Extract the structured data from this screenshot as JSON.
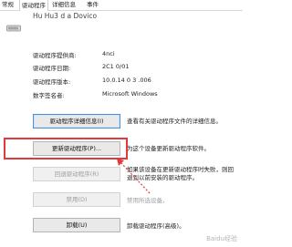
{
  "tabs": [
    "常规",
    "驱动程序",
    "详细信息",
    "事件"
  ],
  "device": {
    "name": "Hu Hu3 d a Dovico",
    "icon": "device-icon"
  },
  "info_rows": [
    {
      "label": "驱动程序提供商:",
      "value": "4nci"
    },
    {
      "label": "驱动程序日期:",
      "value": "2C1 0/01"
    },
    {
      "label": "驱动程序版本:",
      "value": "10.0.14 0 3 .006"
    },
    {
      "label": "数字签名者:",
      "value": "Microsoft Windows"
    }
  ],
  "actions": [
    {
      "button": "驱动程序详细信息(I)",
      "desc": "查看有关驱动程序文件的详细信息。",
      "state": "focus"
    },
    {
      "button": "更新驱动程序(P)...",
      "desc": "为这个设备更新驱动程序软件。",
      "state": "normal"
    },
    {
      "button": "回退驱动程序(R)",
      "desc": "如果该设备在更新驱动程序时失败，则回退到以前安装的驱动程序。",
      "state": "disabled"
    },
    {
      "button": "禁用(D)",
      "desc": "禁用所选设备。",
      "state": "disabled"
    },
    {
      "button": "卸载(U)",
      "desc": "卸载驱动程序(高级)。",
      "state": "normal"
    }
  ],
  "annotation": {
    "highlight_color": "#e23a3a"
  },
  "watermark": "Baidu经验"
}
